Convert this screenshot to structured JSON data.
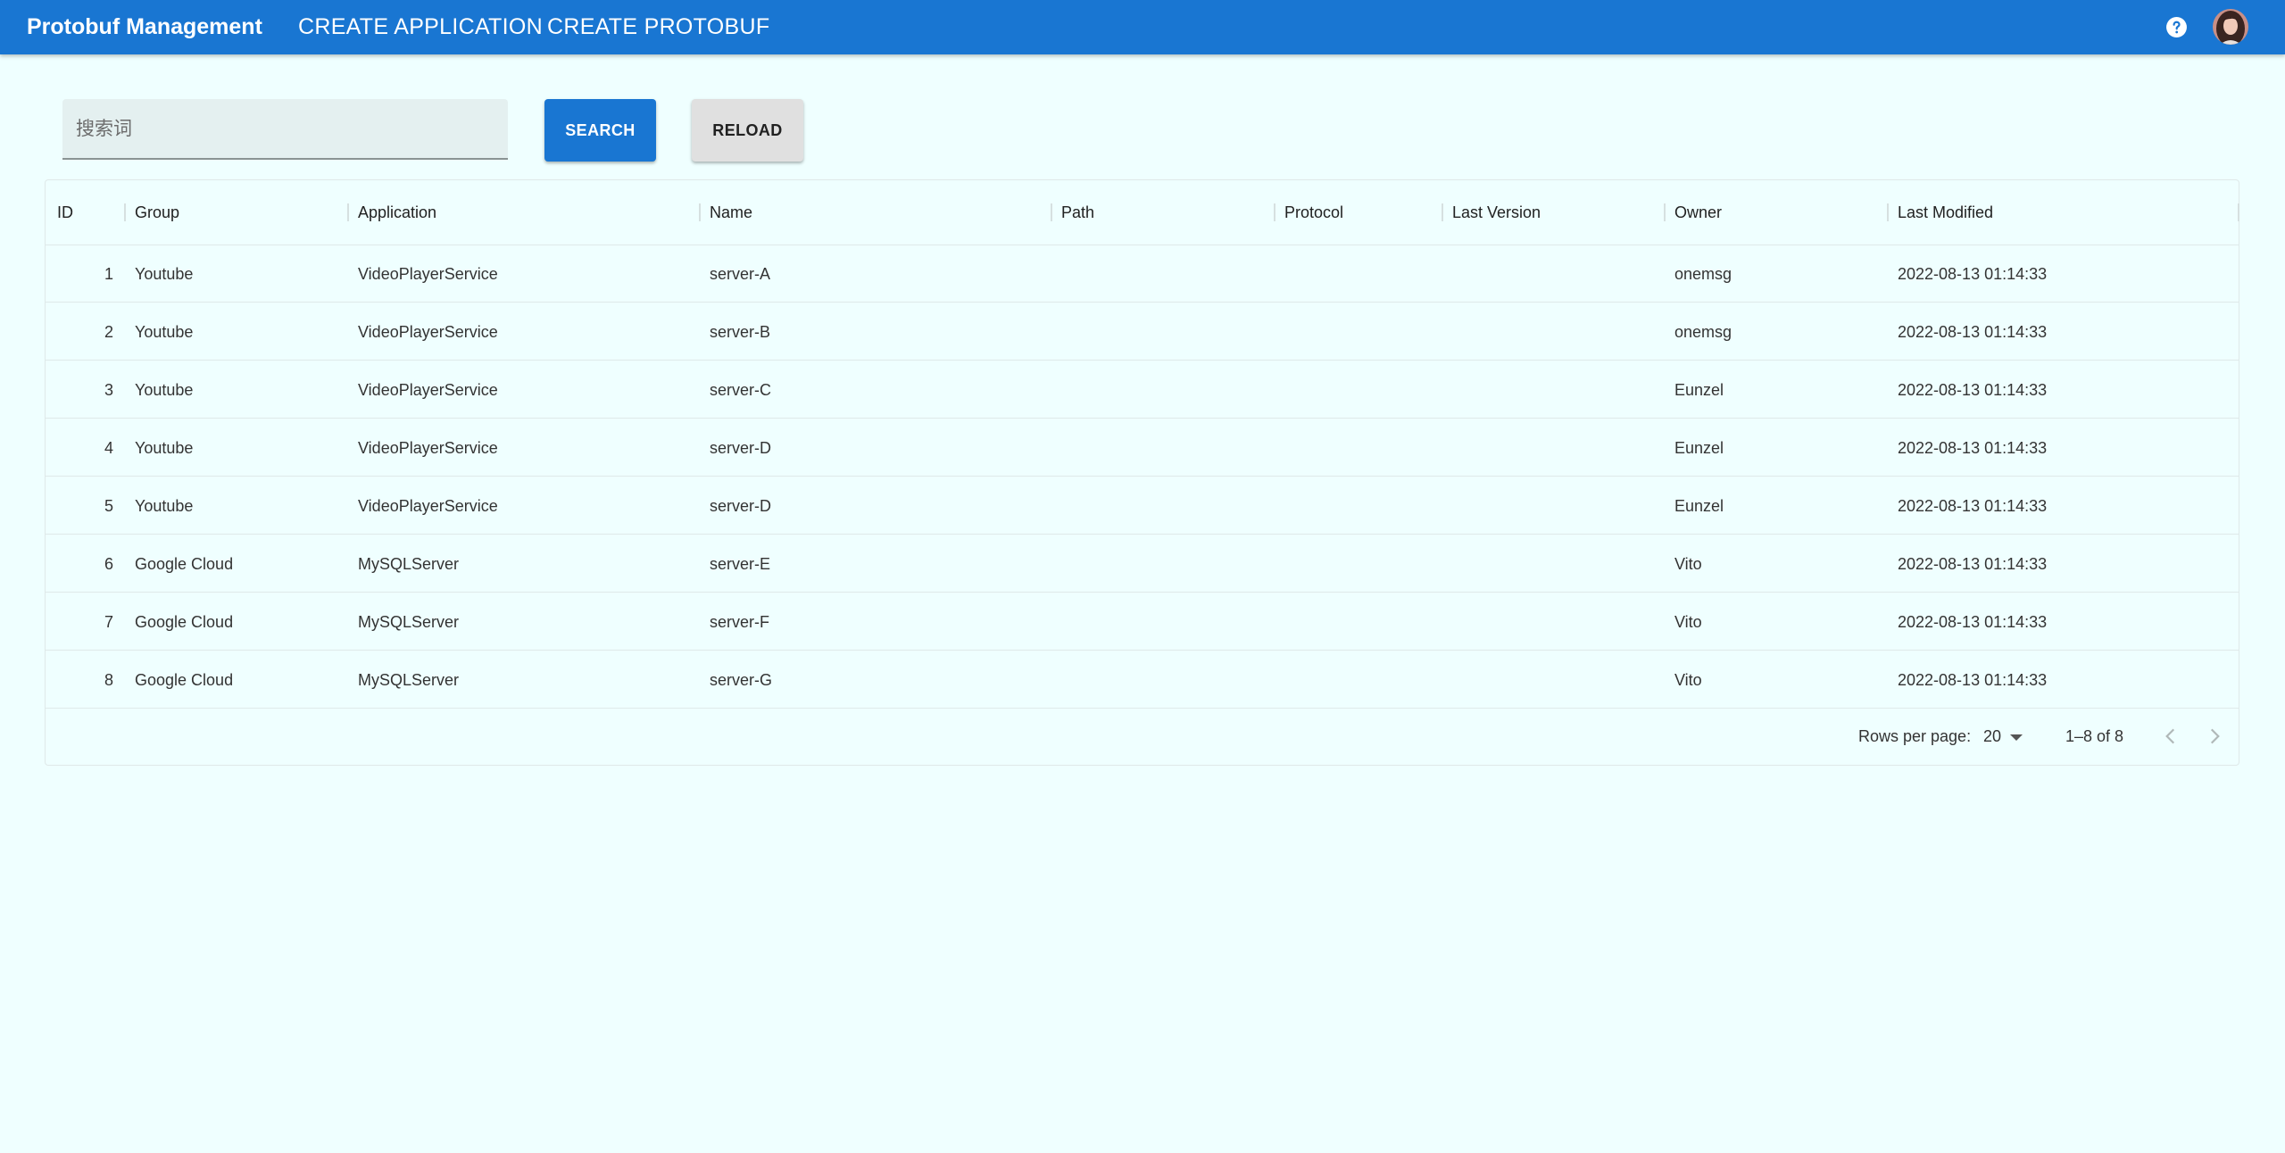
{
  "appbar": {
    "title": "Protobuf Management",
    "nav": [
      "CREATE APPLICATION",
      "CREATE PROTOBUF"
    ],
    "help_icon": "help-circle-icon",
    "avatar": "user-avatar",
    "color": "#1976d2"
  },
  "toolbar": {
    "search_placeholder": "搜索词",
    "search_value": "",
    "search_label": "SEARCH",
    "reload_label": "RELOAD"
  },
  "table": {
    "columns": [
      "ID",
      "Group",
      "Application",
      "Name",
      "Path",
      "Protocol",
      "Last Version",
      "Owner",
      "Last Modified"
    ],
    "rows": [
      {
        "id": "1",
        "group": "Youtube",
        "application": "VideoPlayerService",
        "name": "server-A",
        "path": "",
        "protocol": "",
        "last_version": "",
        "owner": "onemsg",
        "last_modified": "2022-08-13 01:14:33"
      },
      {
        "id": "2",
        "group": "Youtube",
        "application": "VideoPlayerService",
        "name": "server-B",
        "path": "",
        "protocol": "",
        "last_version": "",
        "owner": "onemsg",
        "last_modified": "2022-08-13 01:14:33"
      },
      {
        "id": "3",
        "group": "Youtube",
        "application": "VideoPlayerService",
        "name": "server-C",
        "path": "",
        "protocol": "",
        "last_version": "",
        "owner": "Eunzel",
        "last_modified": "2022-08-13 01:14:33"
      },
      {
        "id": "4",
        "group": "Youtube",
        "application": "VideoPlayerService",
        "name": "server-D",
        "path": "",
        "protocol": "",
        "last_version": "",
        "owner": "Eunzel",
        "last_modified": "2022-08-13 01:14:33"
      },
      {
        "id": "5",
        "group": "Youtube",
        "application": "VideoPlayerService",
        "name": "server-D",
        "path": "",
        "protocol": "",
        "last_version": "",
        "owner": "Eunzel",
        "last_modified": "2022-08-13 01:14:33"
      },
      {
        "id": "6",
        "group": "Google Cloud",
        "application": "MySQLServer",
        "name": "server-E",
        "path": "",
        "protocol": "",
        "last_version": "",
        "owner": "Vito",
        "last_modified": "2022-08-13 01:14:33"
      },
      {
        "id": "7",
        "group": "Google Cloud",
        "application": "MySQLServer",
        "name": "server-F",
        "path": "",
        "protocol": "",
        "last_version": "",
        "owner": "Vito",
        "last_modified": "2022-08-13 01:14:33"
      },
      {
        "id": "8",
        "group": "Google Cloud",
        "application": "MySQLServer",
        "name": "server-G",
        "path": "",
        "protocol": "",
        "last_version": "",
        "owner": "Vito",
        "last_modified": "2022-08-13 01:14:33"
      }
    ]
  },
  "pagination": {
    "rows_per_page_label": "Rows per page:",
    "rows_per_page_value": "20",
    "range_text": "1–8 of 8",
    "prev_icon": "chevron-left-icon",
    "next_icon": "chevron-right-icon"
  }
}
